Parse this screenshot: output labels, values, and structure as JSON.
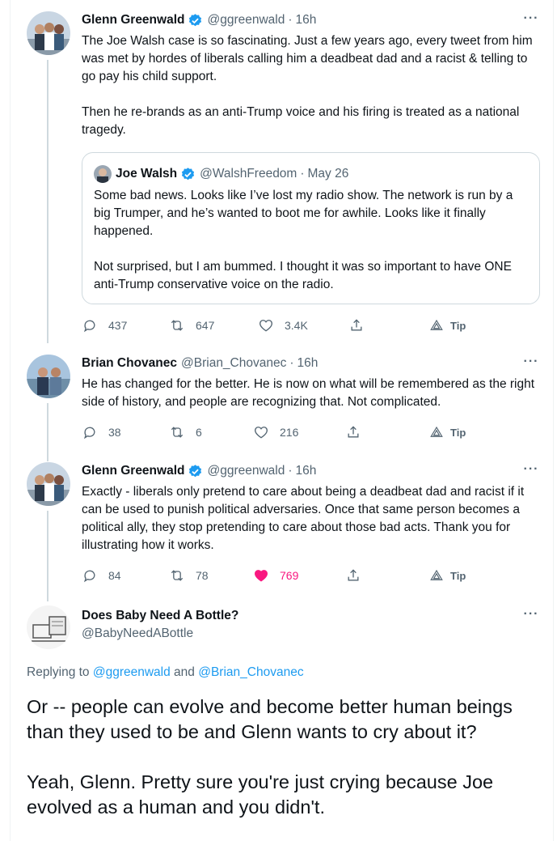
{
  "tweets": [
    {
      "name": "Glenn Greenwald",
      "handle": "@ggreenwald",
      "dot": "·",
      "time": "16h",
      "text": "The Joe Walsh case is so fascinating. Just a few years ago, every tweet from him was met by hordes of liberals calling him a deadbeat dad and a racist & telling to go pay his child support.\n\nThen he re-brands as an anti-Trump voice and his firing is treated as a national tragedy.",
      "quote": {
        "name": "Joe Walsh",
        "handle": "@WalshFreedom",
        "dot": "·",
        "time": "May 26",
        "text": "Some bad news. Looks like I’ve lost my radio show. The network is run by a big Trumper, and he’s wanted to boot me for awhile. Looks like it finally happened.\n\nNot surprised, but I am bummed. I thought it was so important to have ONE anti-Trump conservative voice on the radio."
      },
      "replies": "437",
      "retweets": "647",
      "likes": "3.4K",
      "tip": "Tip"
    },
    {
      "name": "Brian Chovanec",
      "handle": "@Brian_Chovanec",
      "dot": "·",
      "time": "16h",
      "text": "He has changed for the better. He is now on what will be remembered as the right side of history, and people are recognizing that. Not complicated.",
      "replies": "38",
      "retweets": "6",
      "likes": "216",
      "tip": "Tip"
    },
    {
      "name": "Glenn Greenwald",
      "handle": "@ggreenwald",
      "dot": "·",
      "time": "16h",
      "text": "Exactly - liberals only pretend to care about being a deadbeat dad and racist if it can be used to punish political adversaries. Once that same person becomes a political ally, they stop pretending to care about those bad acts. Thank you for illustrating how it works.",
      "replies": "84",
      "retweets": "78",
      "likes": "769",
      "tip": "Tip"
    }
  ],
  "focused": {
    "name": "Does Baby Need A Bottle?",
    "handle": "@BabyNeedABottle",
    "replying_prefix": "Replying to ",
    "replying_user1": "@ggreenwald",
    "replying_and": " and ",
    "replying_user2": "@Brian_Chovanec",
    "text": "Or -- people can evolve and become better human beings than they used to be and Glenn wants to cry about it?\n\nYeah, Glenn. Pretty sure you're just crying because Joe evolved as a human and you didn't."
  },
  "colors": {
    "accent": "#1d9bf0",
    "like_active": "#f91880",
    "muted": "#536471",
    "border": "#cfd9de"
  },
  "icons": [
    "verified-badge-icon",
    "more-icon",
    "reply-icon",
    "retweet-icon",
    "like-icon",
    "share-icon",
    "tip-icon"
  ]
}
